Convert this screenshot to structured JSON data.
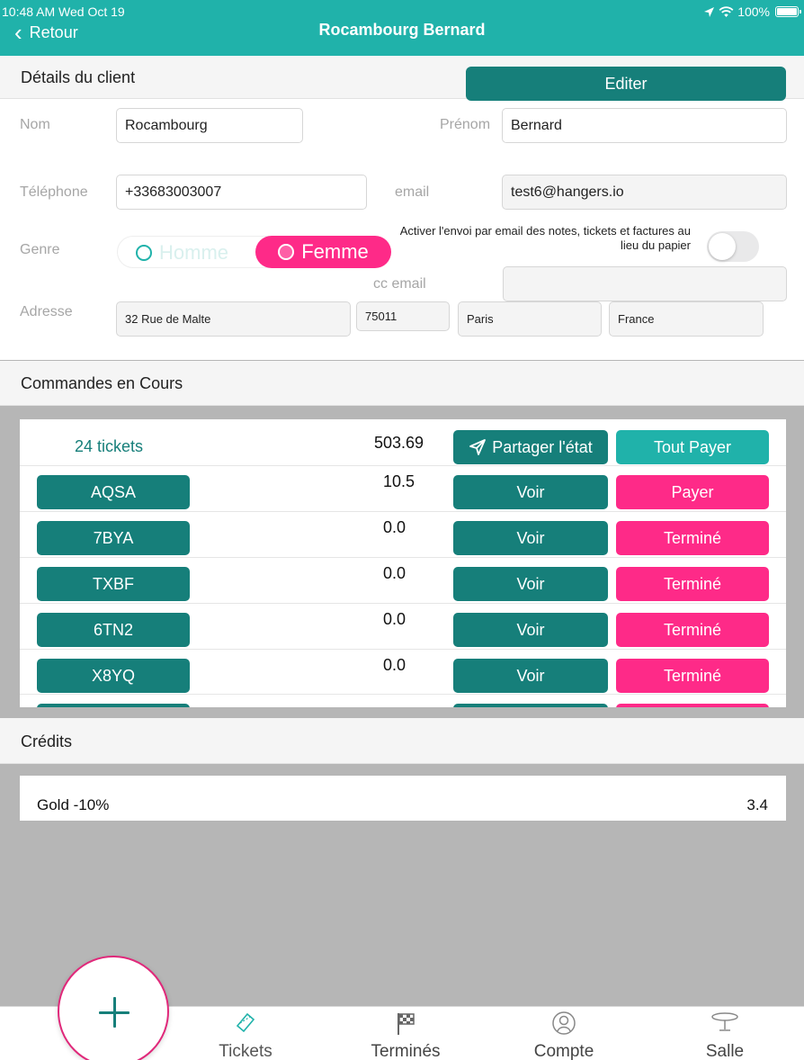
{
  "status_bar": {
    "time": "10:48 AM  Wed Oct 19",
    "battery": "100%"
  },
  "nav": {
    "back_label": "Retour",
    "title": "Rocambourg Bernard"
  },
  "details": {
    "header": "Détails du client",
    "edit_label": "Editer",
    "labels": {
      "nom": "Nom",
      "prenom": "Prénom",
      "telephone": "Téléphone",
      "email": "email",
      "genre": "Genre",
      "cc_email": "cc email",
      "adresse": "Adresse"
    },
    "values": {
      "nom": "Rocambourg",
      "prenom": "Bernard",
      "telephone": "+33683003007",
      "email": "test6@hangers.io",
      "cc_email": "",
      "street": "32 Rue de Malte",
      "postal_code": "75011",
      "city": "Paris",
      "country": "France"
    },
    "gender": {
      "option_male": "Homme",
      "option_female": "Femme",
      "selected": "Femme"
    },
    "email_toggle_label": "Activer l'envoi par email des notes, tickets et factures au lieu du papier",
    "email_toggle_on": false
  },
  "orders": {
    "header": "Commandes en Cours",
    "total_count": "24 tickets",
    "total_amount": "503.69",
    "share_label": "Partager l'état",
    "pay_all_label": "Tout Payer",
    "view_label": "Voir",
    "rows": [
      {
        "code": "AQSA",
        "amount": "10.5",
        "action": "Payer"
      },
      {
        "code": "7BYA",
        "amount": "0.0",
        "action": "Terminé"
      },
      {
        "code": "TXBF",
        "amount": "0.0",
        "action": "Terminé"
      },
      {
        "code": "6TN2",
        "amount": "0.0",
        "action": "Terminé"
      },
      {
        "code": "X8YQ",
        "amount": "0.0",
        "action": "Terminé"
      }
    ]
  },
  "credits": {
    "header": "Crédits",
    "items": [
      {
        "name": "Gold -10%",
        "value": "3.4"
      }
    ]
  },
  "tabbar": {
    "tabs": [
      {
        "label": "Tickets",
        "icon": "ticket-icon"
      },
      {
        "label": "Terminés",
        "icon": "checkered-flag-icon"
      },
      {
        "label": "Compte",
        "icon": "user-circle-icon"
      },
      {
        "label": "Salle",
        "icon": "table-icon"
      }
    ],
    "fab_icon": "plus-icon"
  },
  "colors": {
    "teal": "#20b2aa",
    "dark_teal": "#167f7a",
    "pink": "#fe2a88",
    "background": "#b6b6b6"
  }
}
